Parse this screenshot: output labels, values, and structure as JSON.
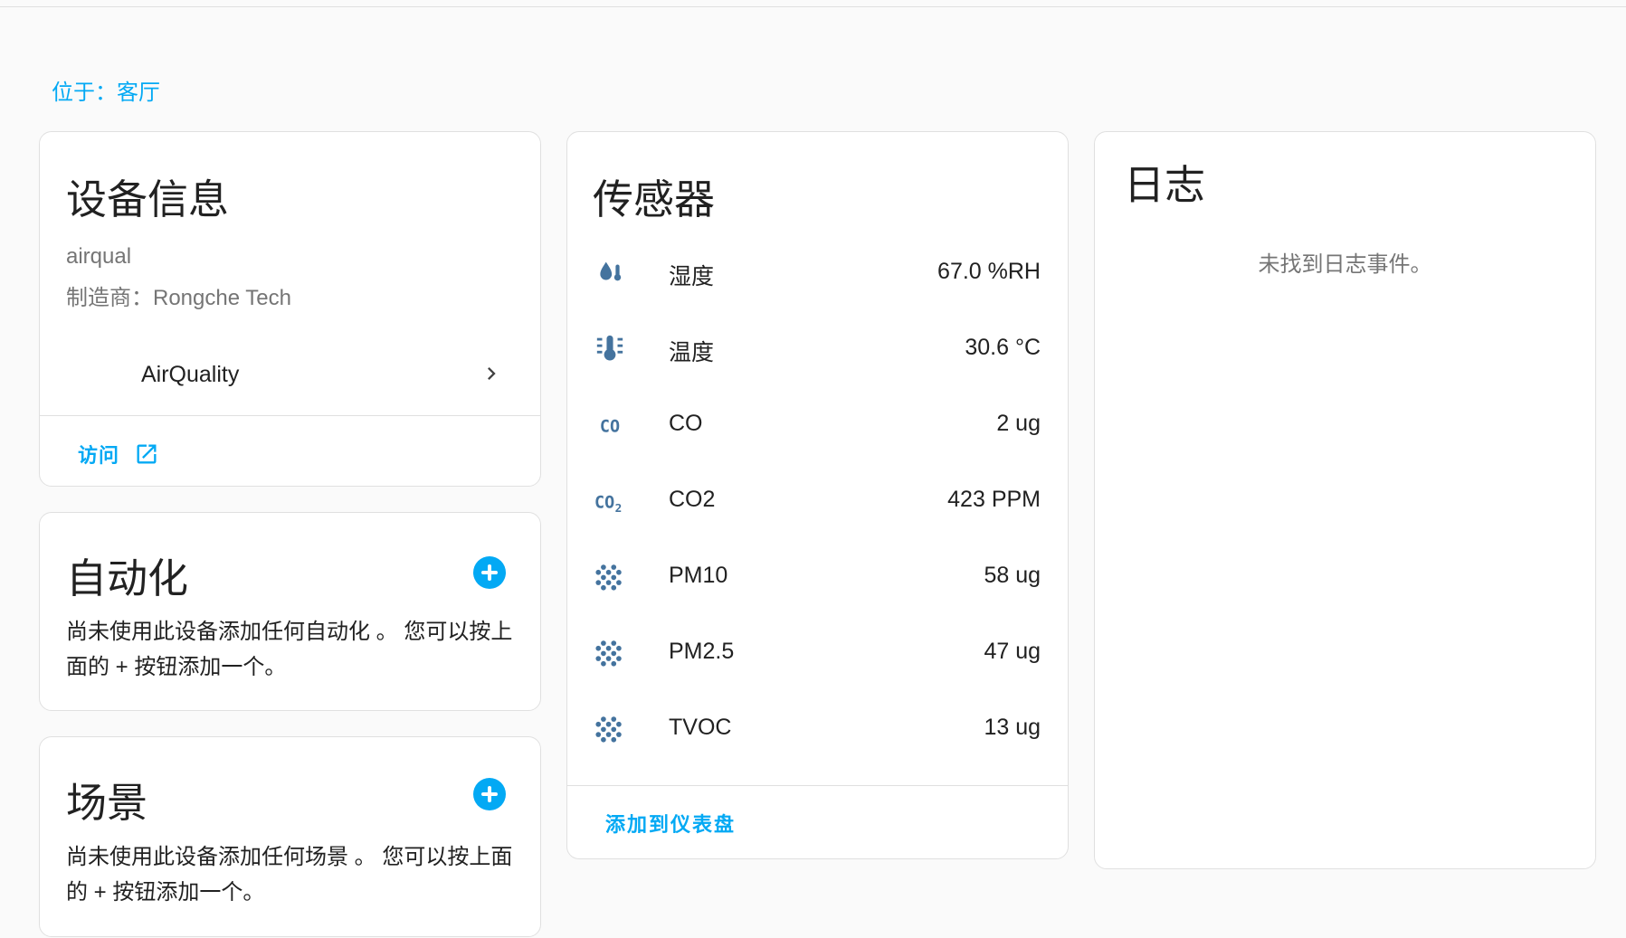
{
  "location": "位于：客厅",
  "device_card": {
    "title": "设备信息",
    "model": "airqual",
    "manufacturer": "制造商：Rongche Tech",
    "subdevice": "AirQuality",
    "visit_label": "访问"
  },
  "automation_card": {
    "title": "自动化",
    "empty_text": "尚未使用此设备添加任何自动化 。 您可以按上面的 + 按钮添加一个。"
  },
  "scene_card": {
    "title": "场景",
    "empty_text": "尚未使用此设备添加任何场景 。 您可以按上面的 + 按钮添加一个。"
  },
  "sensors_card": {
    "title": "传感器",
    "items": [
      {
        "icon": "humidity-icon",
        "name": "湿度",
        "value": "67.0 %RH"
      },
      {
        "icon": "thermometer-icon",
        "name": "温度",
        "value": "30.6 °C"
      },
      {
        "icon": "co-icon",
        "name": "CO",
        "value": "2 ug"
      },
      {
        "icon": "co2-icon",
        "name": "CO2",
        "value": "423 PPM"
      },
      {
        "icon": "particles-icon",
        "name": "PM10",
        "value": "58 ug"
      },
      {
        "icon": "particles-icon",
        "name": "PM2.5",
        "value": "47 ug"
      },
      {
        "icon": "particles-icon",
        "name": "TVOC",
        "value": "13 ug"
      }
    ],
    "add_to_dashboard": "添加到仪表盘"
  },
  "log_card": {
    "title": "日志",
    "empty_text": "未找到日志事件。"
  },
  "colors": {
    "accent": "#03a9f4",
    "icon": "#44739e",
    "text_primary": "#212121",
    "text_secondary": "#757575"
  }
}
